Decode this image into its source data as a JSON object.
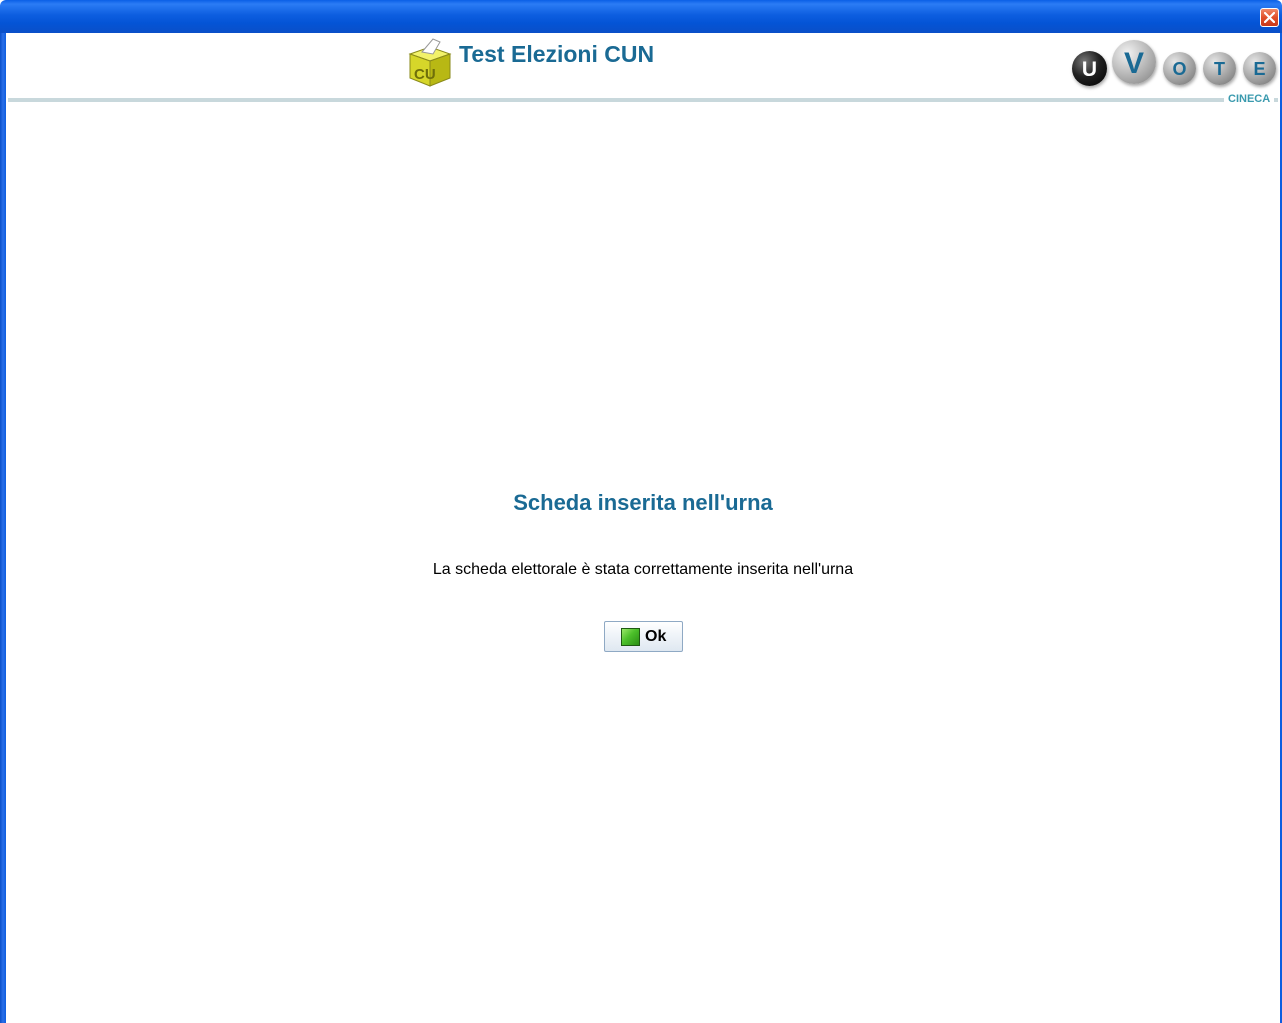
{
  "window": {
    "close_icon": "close-icon"
  },
  "header": {
    "logo_icon": "ballot-box-icon",
    "logo_letters": "CU",
    "title": "Test Elezioni CUN",
    "brand_letters": [
      "U",
      "V",
      "O",
      "T",
      "E"
    ],
    "brand_caption": "CINECA"
  },
  "message": {
    "title": "Scheda inserita nell'urna",
    "body": "La scheda elettorale è stata correttamente inserita nell'urna"
  },
  "ok_button": {
    "label": "Ok",
    "icon": "green-square-icon"
  },
  "colors": {
    "title_bar": "#0d5ee0",
    "accent": "#1a6a94",
    "close_button": "#e0502a",
    "divider": "#c8d8dc",
    "ok_icon": "#4cc02a"
  }
}
